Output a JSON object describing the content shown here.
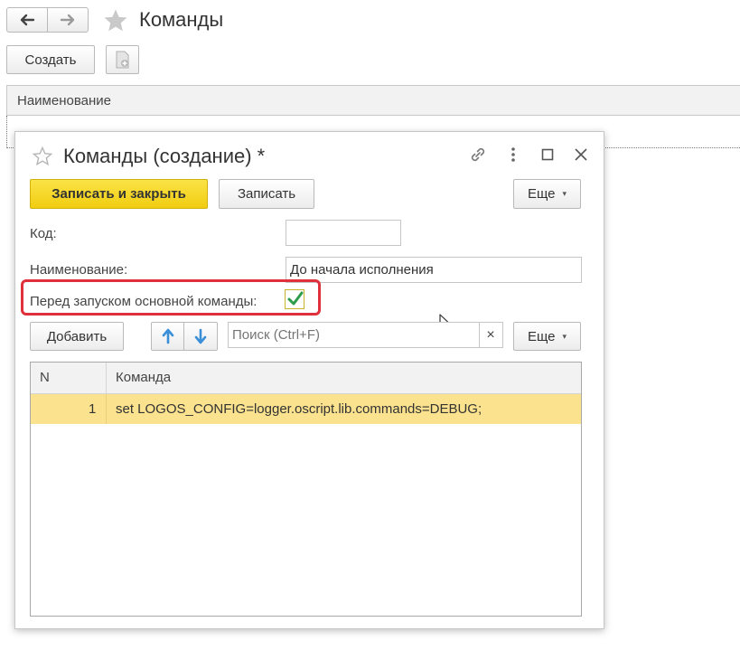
{
  "main": {
    "title": "Команды",
    "create_button": "Создать",
    "column_header": "Наименование"
  },
  "dialog": {
    "title": "Команды (создание) *",
    "toolbar": {
      "save_close": "Записать и закрыть",
      "save": "Записать",
      "more": "Еще"
    },
    "form": {
      "code_label": "Код:",
      "code_value": "",
      "name_label": "Наименование:",
      "name_value": "До начала исполнения",
      "before_main_label": "Перед запуском основной команды:",
      "before_main_checked": true
    },
    "table_toolbar": {
      "add": "Добавить",
      "search_placeholder": "Поиск (Ctrl+F)",
      "clear": "×",
      "more": "Еще"
    },
    "table": {
      "columns": [
        "N",
        "Команда"
      ],
      "rows": [
        {
          "n": "1",
          "command": "set LOGOS_CONFIG=logger.oscript.lib.commands=DEBUG;"
        }
      ]
    }
  },
  "colors": {
    "accent_button": "#f5d51b",
    "selected_row": "#fbe28e",
    "highlight_frame": "#e0303b",
    "check_mark": "#2d9d4c",
    "arrow_blue": "#3a8fd8"
  }
}
